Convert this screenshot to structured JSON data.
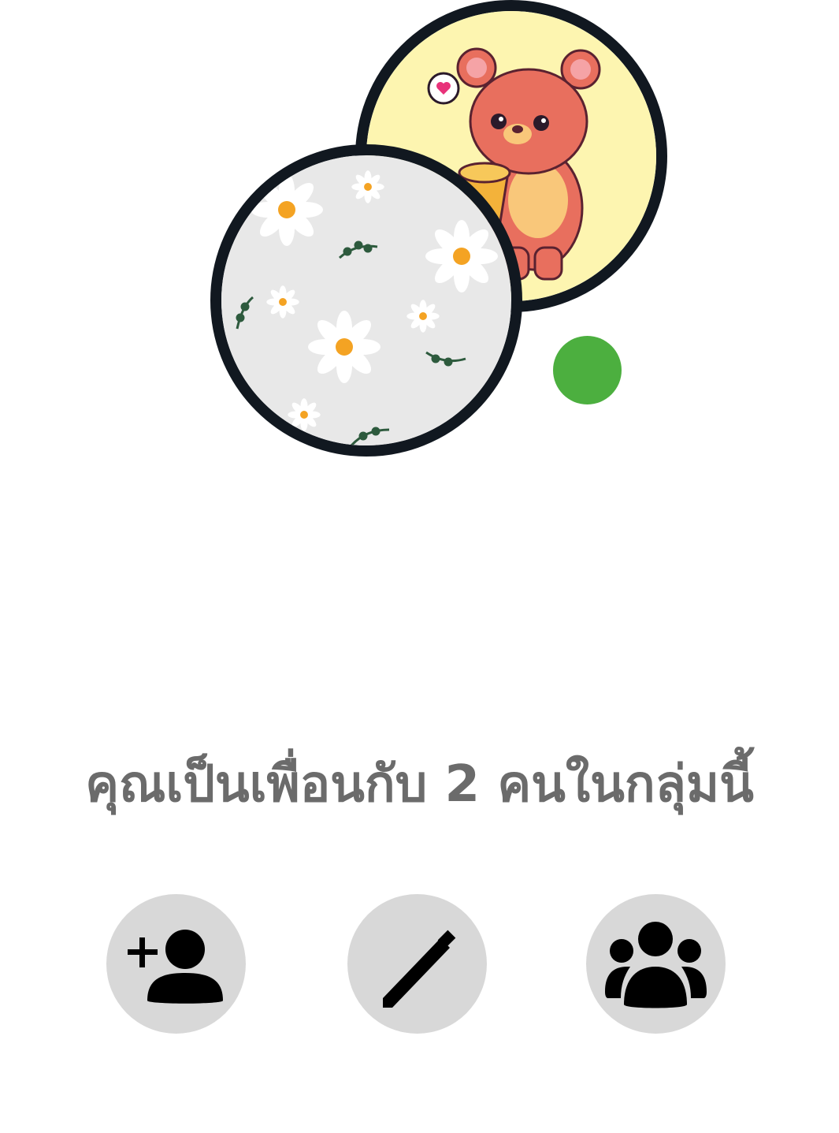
{
  "group_header": {
    "caption": "คุณเป็นเพื่อนกับ 2 คนในกลุ่มนี้",
    "online_status": "online"
  },
  "avatars": [
    {
      "name": "bear-avatar",
      "icon": "bear-holding-honey-illustration",
      "background": "#fdf5b0"
    },
    {
      "name": "daisy-avatar",
      "icon": "daisy-pattern-illustration",
      "background": "#e8e8e8"
    }
  ],
  "actions": [
    {
      "name": "add-member",
      "icon": "person-add-icon"
    },
    {
      "name": "edit",
      "icon": "pencil-icon"
    },
    {
      "name": "members",
      "icon": "group-people-icon"
    }
  ],
  "colors": {
    "caption_text": "#6b6b6b",
    "action_background": "#d8d8d8",
    "icon": "#000000",
    "online_indicator": "#4caf3f",
    "avatar_border": "#111820"
  }
}
